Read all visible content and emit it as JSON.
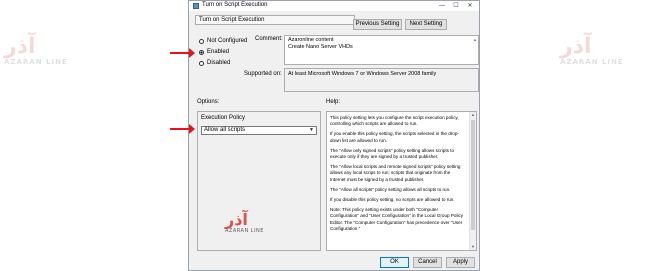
{
  "window": {
    "title": "Turn on Script Execution",
    "controls": [
      "—",
      "☐",
      "✕"
    ]
  },
  "header": {
    "policy_name": "Turn on Script Execution",
    "prev_button": "Previous Setting",
    "next_button": "Next Setting"
  },
  "state": {
    "options": [
      {
        "label": "Not Configured",
        "checked": false
      },
      {
        "label": "Enabled",
        "checked": true
      },
      {
        "label": "Disabled",
        "checked": false
      }
    ]
  },
  "comment": {
    "label": "Comment:",
    "lines": [
      "Azaronline content",
      "Create Nano Server VHDs"
    ]
  },
  "supported": {
    "label": "Supported on:",
    "value": "At least Microsoft Windows 7 or Windows Server 2008 family"
  },
  "options_pane": {
    "heading": "Options:",
    "field_label": "Execution Policy",
    "selected_value": "Allow all scripts"
  },
  "help_pane": {
    "heading": "Help:",
    "paragraphs": [
      "This policy setting lets you configure the script execution policy, controlling which scripts are allowed to run.",
      "If you enable this policy setting, the scripts selected in the drop-down list are allowed to run.",
      "The \"Allow only signed scripts\" policy setting allows scripts to execute only if they are signed by a trusted publisher.",
      "The \"Allow local scripts and remote signed scripts\" policy setting allows any local scrips to run; scripts that originate from the Internet must be signed by a trusted publisher.",
      "The \"Allow all scripts\" policy setting allows all scripts to run.",
      "If you disable this policy setting, no scripts are allowed to run.",
      "Note: This policy setting exists under both \"Computer Configuration\" and \"User Configuration\" in the Local Group Policy Editor. The \"Computer Configuration\" has precedence over \"User Configuration.\""
    ]
  },
  "footer": {
    "ok": "OK",
    "cancel": "Cancel",
    "apply": "Apply"
  },
  "watermark": {
    "brand_big": "آذر",
    "brand_small": "AZARAN LINE"
  },
  "colors": {
    "annotation_arrow": "#e3141c",
    "ok_border": "#0078d7"
  }
}
